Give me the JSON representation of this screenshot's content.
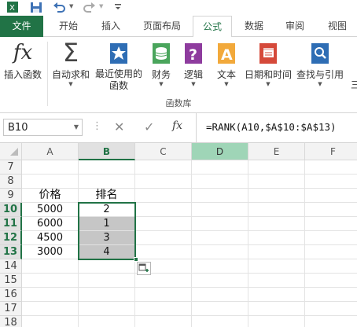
{
  "quick_access": {
    "save_icon": "save-icon",
    "undo_icon": "undo-icon",
    "redo_icon": "redo-icon"
  },
  "tabs": [
    {
      "label": "文件"
    },
    {
      "label": "开始"
    },
    {
      "label": "插入"
    },
    {
      "label": "页面布局"
    },
    {
      "label": "公式"
    },
    {
      "label": "数据"
    },
    {
      "label": "审阅"
    },
    {
      "label": "视图"
    }
  ],
  "ribbon": {
    "insert_function": "插入函数",
    "autosum": "自动求和",
    "recent_line1": "最近使用的",
    "recent_line2": "函数",
    "financial": "财务",
    "logical": "逻辑",
    "text": "文本",
    "datetime": "日期和时间",
    "lookup": "查找与引用",
    "cut_off": "三",
    "group_label": "函数库",
    "fx_glyph": "fx",
    "sigma_glyph": "Σ"
  },
  "formula_bar": {
    "name_box": "B10",
    "fx_glyph": "fx",
    "formula": "=RANK(A10,$A$10:$A$13)"
  },
  "columns": [
    "A",
    "B",
    "C",
    "D",
    "E",
    "F"
  ],
  "rows": [
    "7",
    "8",
    "9",
    "10",
    "11",
    "12",
    "13",
    "14",
    "15",
    "16",
    "17",
    "18"
  ],
  "cells": {
    "A9": "价格",
    "B9": "排名",
    "A10": "5000",
    "B10": "2",
    "A11": "6000",
    "B11": "1",
    "A12": "4500",
    "B12": "3",
    "A13": "3000",
    "B13": "4"
  },
  "colors": {
    "accent": "#217346",
    "selection_fill": "#c6c6c6",
    "col_d_header": "#9fd5b7"
  }
}
